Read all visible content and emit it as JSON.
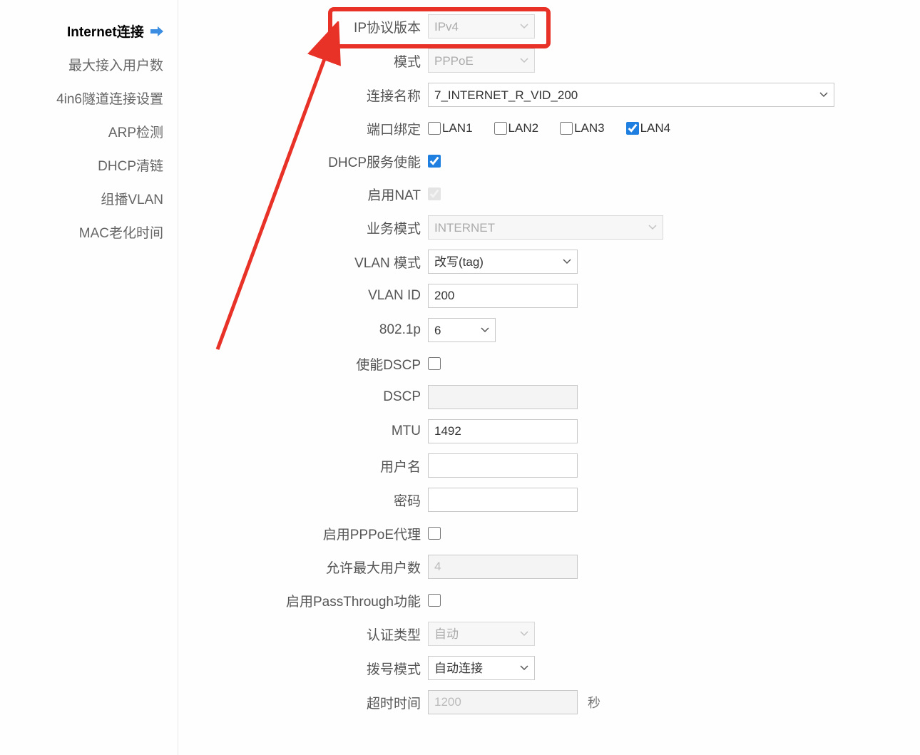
{
  "sidebar": {
    "items": [
      {
        "label": "Internet连接",
        "active": true
      },
      {
        "label": "最大接入用户数",
        "active": false
      },
      {
        "label": "4in6隧道连接设置",
        "active": false
      },
      {
        "label": "ARP检测",
        "active": false
      },
      {
        "label": "DHCP清链",
        "active": false
      },
      {
        "label": "组播VLAN",
        "active": false
      },
      {
        "label": "MAC老化时间",
        "active": false
      }
    ]
  },
  "form": {
    "ip_version": {
      "label": "IP协议版本",
      "value": "IPv4"
    },
    "mode": {
      "label": "模式",
      "value": "PPPoE"
    },
    "conn_name": {
      "label": "连接名称",
      "value": "7_INTERNET_R_VID_200"
    },
    "port_bind": {
      "label": "端口绑定",
      "options": [
        {
          "label": "LAN1",
          "checked": false
        },
        {
          "label": "LAN2",
          "checked": false
        },
        {
          "label": "LAN3",
          "checked": false
        },
        {
          "label": "LAN4",
          "checked": true
        }
      ]
    },
    "dhcp_enable": {
      "label": "DHCP服务使能",
      "checked": true
    },
    "nat_enable": {
      "label": "启用NAT",
      "checked": true,
      "disabled": true
    },
    "service_mode": {
      "label": "业务模式",
      "value": "INTERNET"
    },
    "vlan_mode": {
      "label": "VLAN 模式",
      "value": "改写(tag)"
    },
    "vlan_id": {
      "label": "VLAN ID",
      "value": "200"
    },
    "dot1p": {
      "label": "802.1p",
      "value": "6"
    },
    "dscp_enable": {
      "label": "使能DSCP",
      "checked": false
    },
    "dscp": {
      "label": "DSCP",
      "value": ""
    },
    "mtu": {
      "label": "MTU",
      "value": "1492"
    },
    "username": {
      "label": "用户名",
      "value": ""
    },
    "password": {
      "label": "密码",
      "value": ""
    },
    "pppoe_proxy": {
      "label": "启用PPPoE代理",
      "checked": false
    },
    "max_users": {
      "label": "允许最大用户数",
      "value": "4"
    },
    "passthrough": {
      "label": "启用PassThrough功能",
      "checked": false
    },
    "auth_type": {
      "label": "认证类型",
      "value": "自动"
    },
    "dial_mode": {
      "label": "拨号模式",
      "value": "自动连接"
    },
    "timeout": {
      "label": "超时时间",
      "value": "1200",
      "unit": "秒"
    }
  }
}
